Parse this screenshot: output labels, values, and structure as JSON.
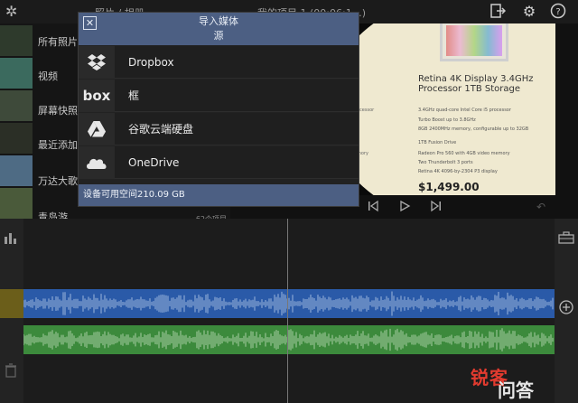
{
  "topbar": {
    "behind_title": "照片 / 相册",
    "behind_project": "我的项目 1 (00:06:1…)",
    "icons": [
      "gear-icon",
      "export-icon",
      "settings-icon",
      "help-icon"
    ]
  },
  "browser": {
    "categories": [
      "所有照片",
      "视频",
      "屏幕快照",
      "最近添加",
      "万达大歌…",
      "青岛游"
    ],
    "last_count": "62个项目"
  },
  "preview": {
    "spec_head": "Retina 4K Display 3.4GHz Processor 1TB Storage",
    "spec_lines": [
      "3.4GHz quad-core Intel Core i5 processor",
      "Turbo Boost up to 3.8GHz",
      "8GB 2400MHz memory, configurable up to 32GB",
      "1TB Fusion Drive",
      "Radeon Pro 560 with 4GB video memory",
      "Two Thunderbolt 3 ports",
      "Retina 4K 4096-by-2304 P3 display"
    ],
    "spec_left": [
      "ocessor",
      "e",
      "mory",
      "s"
    ],
    "price": "$1,499.00"
  },
  "dialog": {
    "title": "导入媒体",
    "subtitle": "源",
    "close_icon": "close-icon",
    "sources": [
      {
        "label": "Dropbox",
        "icon": "dropbox-icon"
      },
      {
        "label": "框",
        "icon": "box-icon"
      },
      {
        "label": "谷歌云端硬盘",
        "icon": "google-drive-icon"
      },
      {
        "label": "OneDrive",
        "icon": "onedrive-icon"
      }
    ],
    "footer": "设备可用空间210.09 GB"
  },
  "watermark": {
    "text_red": "锐客",
    "text_white": "问答"
  },
  "colors": {
    "dialog_header": "#4c5f83",
    "audio_track_blue": "#2a5aa8",
    "audio_track_green": "#3c8a3c"
  }
}
